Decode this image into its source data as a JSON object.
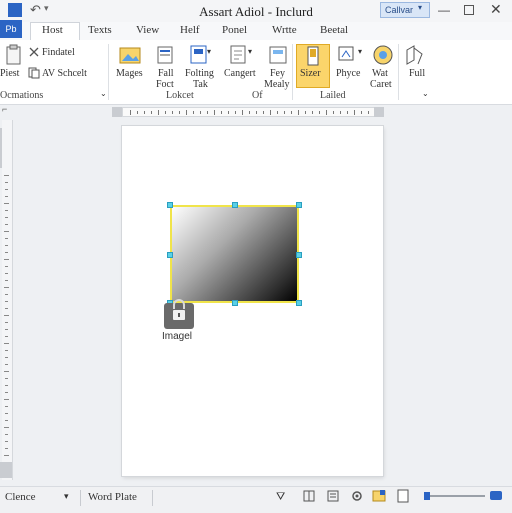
{
  "title": "Assart Adiol - Inclurd",
  "app_badge": "Pb",
  "account": "Callvar",
  "tabs": [
    "Host",
    "Texts",
    "View",
    "Helf",
    "Ponel",
    "Wrtte",
    "Beetal"
  ],
  "ribbon": {
    "clipboard": {
      "paste": "Piest",
      "findtel": "Findatel",
      "schedule": "AV Schcelt",
      "group_label": "Ocmations"
    },
    "insert": {
      "images": "Mages",
      "fall_foot_1": "Fall",
      "fall_foot_2": "Foct",
      "folting_1": "Folting",
      "folting_2": "Tak",
      "cangert": "Cangert",
      "fey_mealy_1": "Fey",
      "fey_mealy_2": "Mealy",
      "group_label": "Lokcet",
      "group_label2": "Of"
    },
    "styles": {
      "sizer": "Sizer",
      "phyce": "Phyce",
      "wat_caret_1": "Wat",
      "wat_caret_2": "Caret",
      "full": "Full",
      "group_label": "Lailed"
    }
  },
  "document": {
    "image_caption": "Imagel"
  },
  "status": {
    "left": "Clence",
    "mode": "Word Plate"
  },
  "colors": {
    "accent": "#2b64c4",
    "selection_border": "#f0e44a",
    "handle": "#5ad0e6",
    "sizer_highlight": "#fbd56b"
  }
}
